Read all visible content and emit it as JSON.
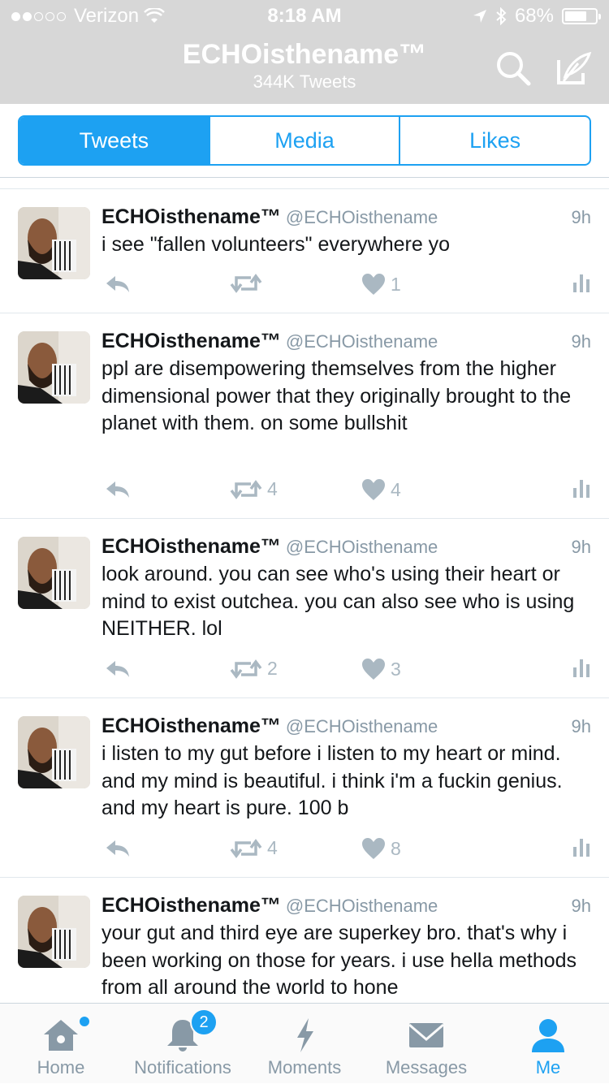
{
  "status_bar": {
    "carrier": "Verizon",
    "time": "8:18 AM",
    "battery": "68%",
    "battery_level": 0.68
  },
  "header": {
    "name": "ECHOisthename™",
    "tweet_count": "344K Tweets"
  },
  "tabs": [
    {
      "label": "Tweets",
      "active": true
    },
    {
      "label": "Media",
      "active": false
    },
    {
      "label": "Likes",
      "active": false
    }
  ],
  "tweets": [
    {
      "name": "ECHOisthename™",
      "handle": "@ECHOisthename",
      "time": "9h",
      "text": "i see \"fallen volunteers\" everywhere yo",
      "retweets": "",
      "likes": "1"
    },
    {
      "name": "ECHOisthename™",
      "handle": "@ECHOisthename",
      "time": "9h",
      "text": "ppl are disempowering themselves from the higher dimensional power that they originally brought to the planet with them. on some bullshit",
      "retweets": "4",
      "likes": "4"
    },
    {
      "name": "ECHOisthename™",
      "handle": "@ECHOisthename",
      "time": "9h",
      "text": "look around. you can see who's using their heart or mind to exist outchea. you can also see who is using NEITHER. lol",
      "retweets": "2",
      "likes": "3"
    },
    {
      "name": "ECHOisthename™",
      "handle": "@ECHOisthename",
      "time": "9h",
      "text": "i listen to my gut before i listen to my heart or mind. and my mind is beautiful. i think i'm a fuckin genius. and my heart is pure. 100 b",
      "retweets": "4",
      "likes": "8"
    },
    {
      "name": "ECHOisthename™",
      "handle": "@ECHOisthename",
      "time": "9h",
      "text": "your gut and third eye are superkey bro. that's why i been working on those for years. i use hella methods from all around the world to hone",
      "retweets": "",
      "likes": ""
    }
  ],
  "tab_bar": {
    "home": "Home",
    "notifications": "Notifications",
    "notifications_badge": "2",
    "moments": "Moments",
    "messages": "Messages",
    "me": "Me"
  },
  "colors": {
    "accent": "#1da1f2",
    "header_bg": "#d7d7d7",
    "muted": "#8899a6",
    "action_gray": "#aab8c2"
  }
}
